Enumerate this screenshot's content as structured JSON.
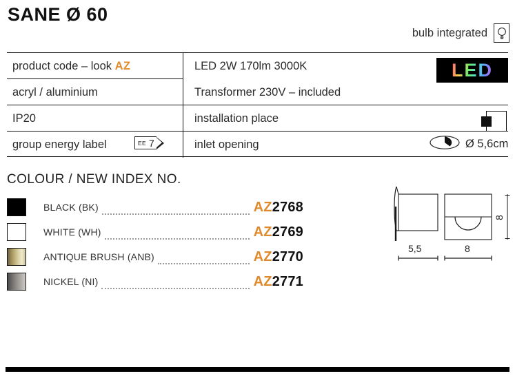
{
  "header": {
    "title": "SANE Ø 60",
    "bulb_label": "bulb integrated",
    "bulb_icon": "light-bulb-icon"
  },
  "spec_table": {
    "rows": [
      {
        "left": "product code – look ",
        "left_accent": "AZ",
        "mid": "LED 2W 170lm 3000K"
      },
      {
        "left": "acryl / aluminium",
        "mid": "Transformer 230V – included"
      },
      {
        "left": "IP20",
        "mid": "installation place"
      },
      {
        "left": "group energy label",
        "mid": "inlet opening"
      }
    ],
    "energy_label": {
      "prefix": "EE",
      "value": "7"
    },
    "led_logo_text": "LED",
    "inlet_opening_value": "Ø 5,6cm",
    "install_icon": "wall-mount-icon",
    "inlet_icon": "inlet-opening-icon"
  },
  "colour_section": {
    "heading": "COLOUR / NEW INDEX NO.",
    "items": [
      {
        "name": "BLACK (BK)",
        "code_prefix": "AZ",
        "code_number": "2768",
        "swatch": "black",
        "swatch_color": "#000000"
      },
      {
        "name": "WHITE (WH)",
        "code_prefix": "AZ",
        "code_number": "2769",
        "swatch": "white",
        "swatch_color": "#ffffff"
      },
      {
        "name": "ANTIQUE BRUSH (ANB)",
        "code_prefix": "AZ",
        "code_number": "2770",
        "swatch": "antique-brush",
        "swatch_color": "#c6b98a"
      },
      {
        "name": "NICKEL (NI)",
        "code_prefix": "AZ",
        "code_number": "2771",
        "swatch": "nickel",
        "swatch_color": "#9a9793"
      }
    ]
  },
  "drawing": {
    "depth_label": "5,5",
    "width_label": "8",
    "height_label": "8"
  },
  "colors": {
    "accent_orange": "#e08a2e",
    "text": "#2a2a2a",
    "rule": "#111111"
  }
}
